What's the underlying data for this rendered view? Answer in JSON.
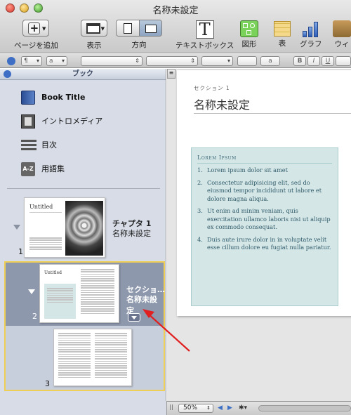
{
  "window": {
    "title": "名称未設定"
  },
  "toolbar": {
    "add_page": "ページを追加",
    "view": "表示",
    "orientation": "方向",
    "textbox": "テキストボックス",
    "shapes": "図形",
    "table": "表",
    "chart": "グラフ",
    "widget": "ウィ"
  },
  "format_bar": {
    "style_label": "¶",
    "char_label": "a",
    "font_size_label": "a",
    "bold": "B",
    "italic": "I",
    "underline": "U"
  },
  "sidebar": {
    "header": "ブック",
    "items": [
      {
        "label": "Book Title",
        "icon": "book-icon"
      },
      {
        "label": "イントロメディア",
        "icon": "film-icon"
      },
      {
        "label": "目次",
        "icon": "list-icon"
      },
      {
        "label": "用語集",
        "icon": "glossary-icon",
        "icon_text": "A-Z"
      }
    ],
    "chapter": {
      "number": "1",
      "title": "チャプタ 1",
      "subtitle": "名称未設定",
      "thumb_title": "Untitled"
    },
    "section": {
      "number": "2",
      "title": "セクショ…",
      "subtitle": "名称未設定",
      "thumb_title": "Untitled"
    },
    "page3": {
      "number": "3"
    }
  },
  "document": {
    "section_label": "セクション 1",
    "section_title": "名称未設定",
    "box_title": "Lorem Ipsum",
    "list": [
      "Lorem ipsum dolor sit amet",
      "Consectetur adipisicing elit, sed do eiusmod tempor incididunt ut labore et dolore magna aliqua.",
      "Ut enim ad minim veniam, quis exercitation ullamco laboris nisi ut aliquip ex commodo consequat.",
      "Duis aute irure dolor in in voluptate velit esse cillum dolore eu fugiat nulla pariatur."
    ]
  },
  "statusbar": {
    "zoom": "50%"
  }
}
